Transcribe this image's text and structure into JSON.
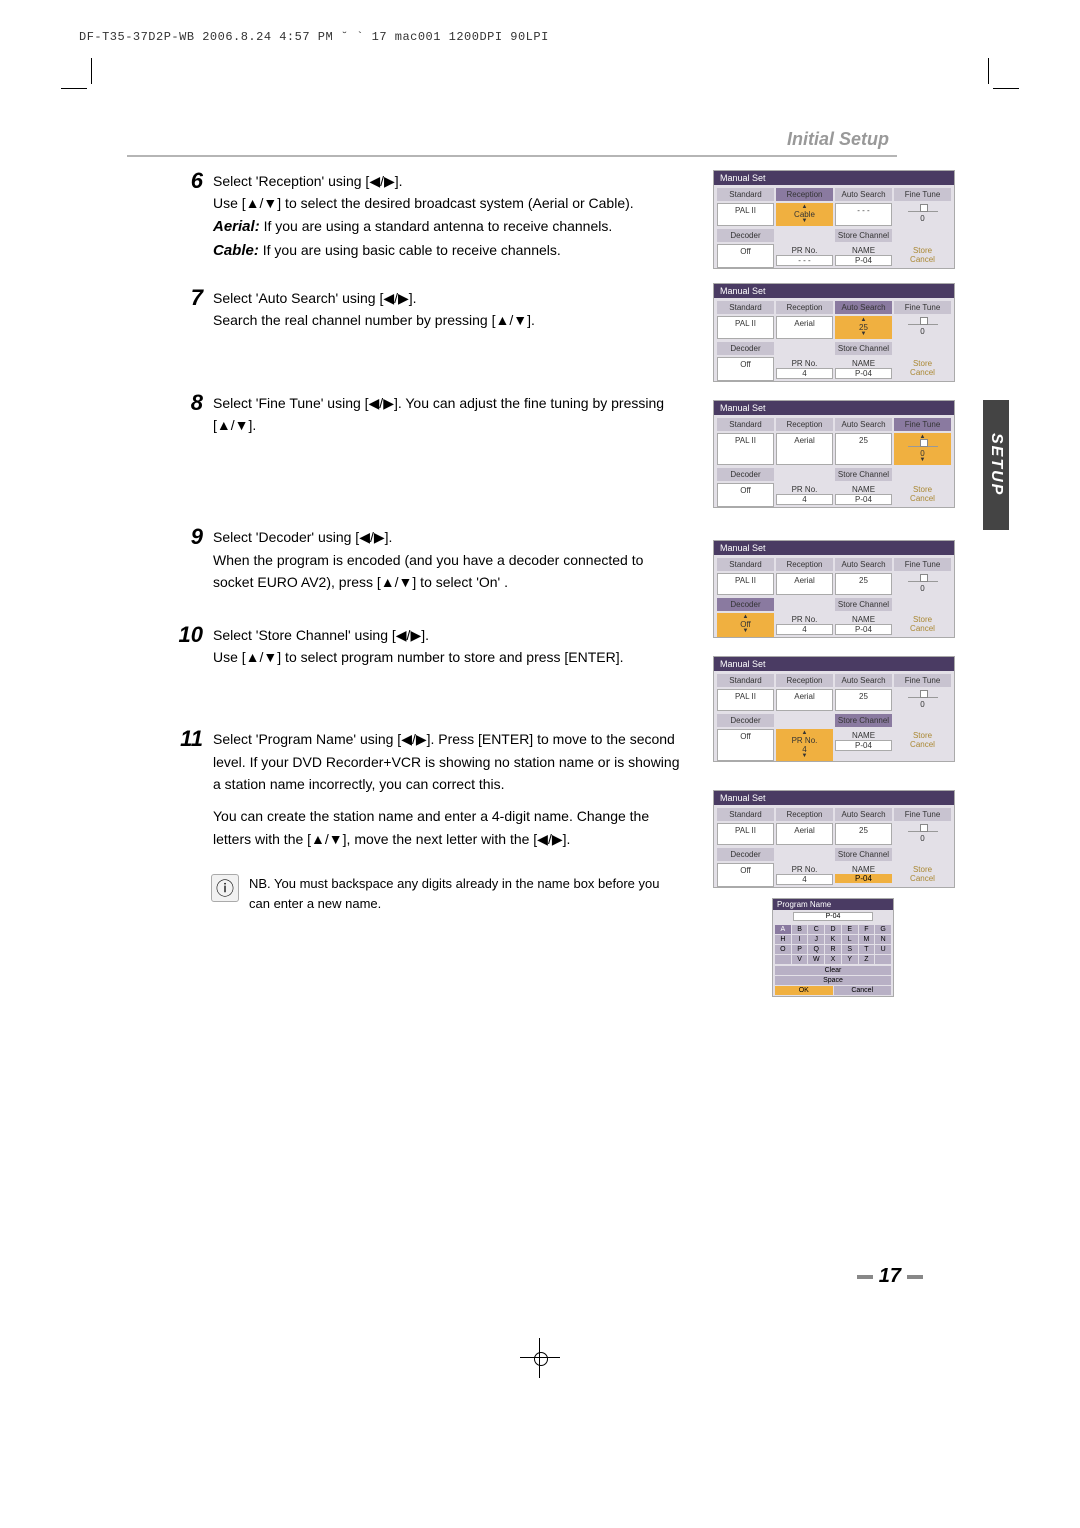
{
  "header": "DF-T35-37D2P-WB  2006.8.24 4:57 PM  ˘ ` 17   mac001   1200DPI 90LPI",
  "section_title": "Initial Setup",
  "side_tab": "SETUP",
  "page_number": "17",
  "steps": {
    "6": {
      "line1": "Select 'Reception' using [◀/▶].",
      "line2": "Use [▲/▼] to select the desired broadcast system (Aerial or Cable).",
      "aerial_label": "Aerial:",
      "aerial_text": "If you are using a standard antenna to receive channels.",
      "cable_label": "Cable:",
      "cable_text": "If you are using basic cable to receive channels."
    },
    "7": {
      "line1": "Select 'Auto Search' using [◀/▶].",
      "line2": "Search the real channel number by pressing [▲/▼]."
    },
    "8": {
      "line1": "Select 'Fine Tune' using [◀/▶]. You can adjust the fine tuning by pressing [▲/▼]."
    },
    "9": {
      "line1": "Select 'Decoder' using [◀/▶].",
      "line2": "When the program is encoded (and you have a decoder connected to socket EURO AV2), press [▲/▼] to select 'On' ."
    },
    "10": {
      "line1": "Select 'Store Channel' using [◀/▶].",
      "line2": "Use [▲/▼] to select program number to store and press [ENTER]."
    },
    "11": {
      "line1": "Select 'Program Name' using [◀/▶]. Press [ENTER] to move to the second level. If your DVD Recorder+VCR is showing no station name or is showing a station name incorrectly, you can correct this.",
      "line2": "You can create the station name and enter a 4-digit name. Change the letters with the [▲/▼], move the next letter with the [◀/▶]."
    }
  },
  "info_note": "NB.  You must backspace any digits already in the name box before you can enter a new name.",
  "menu_labels": {
    "title": "Manual Set",
    "standard": "Standard",
    "reception": "Reception",
    "auto_search": "Auto Search",
    "fine_tune": "Fine Tune",
    "decoder": "Decoder",
    "store_channel": "Store Channel",
    "pr_no": "PR No.",
    "name": "NAME",
    "store": "Store",
    "cancel": "Cancel",
    "pal": "PAL II",
    "aerial": "Aerial",
    "cable": "Cable",
    "off": "Off",
    "p04": "P-04",
    "val25": "25",
    "val4": "4",
    "val0": "0",
    "dashes": "- - -"
  },
  "prog_name": {
    "title": "Program Name",
    "value": "P-04",
    "keys": [
      "A",
      "B",
      "C",
      "D",
      "E",
      "F",
      "G",
      "H",
      "I",
      "J",
      "K",
      "L",
      "M",
      "N",
      "O",
      "P",
      "Q",
      "R",
      "S",
      "T",
      "U",
      "",
      "V",
      "W",
      "X",
      "Y",
      "Z",
      ""
    ],
    "clear": "Clear",
    "space": "Space",
    "ok": "OK",
    "cancel": "Cancel"
  }
}
